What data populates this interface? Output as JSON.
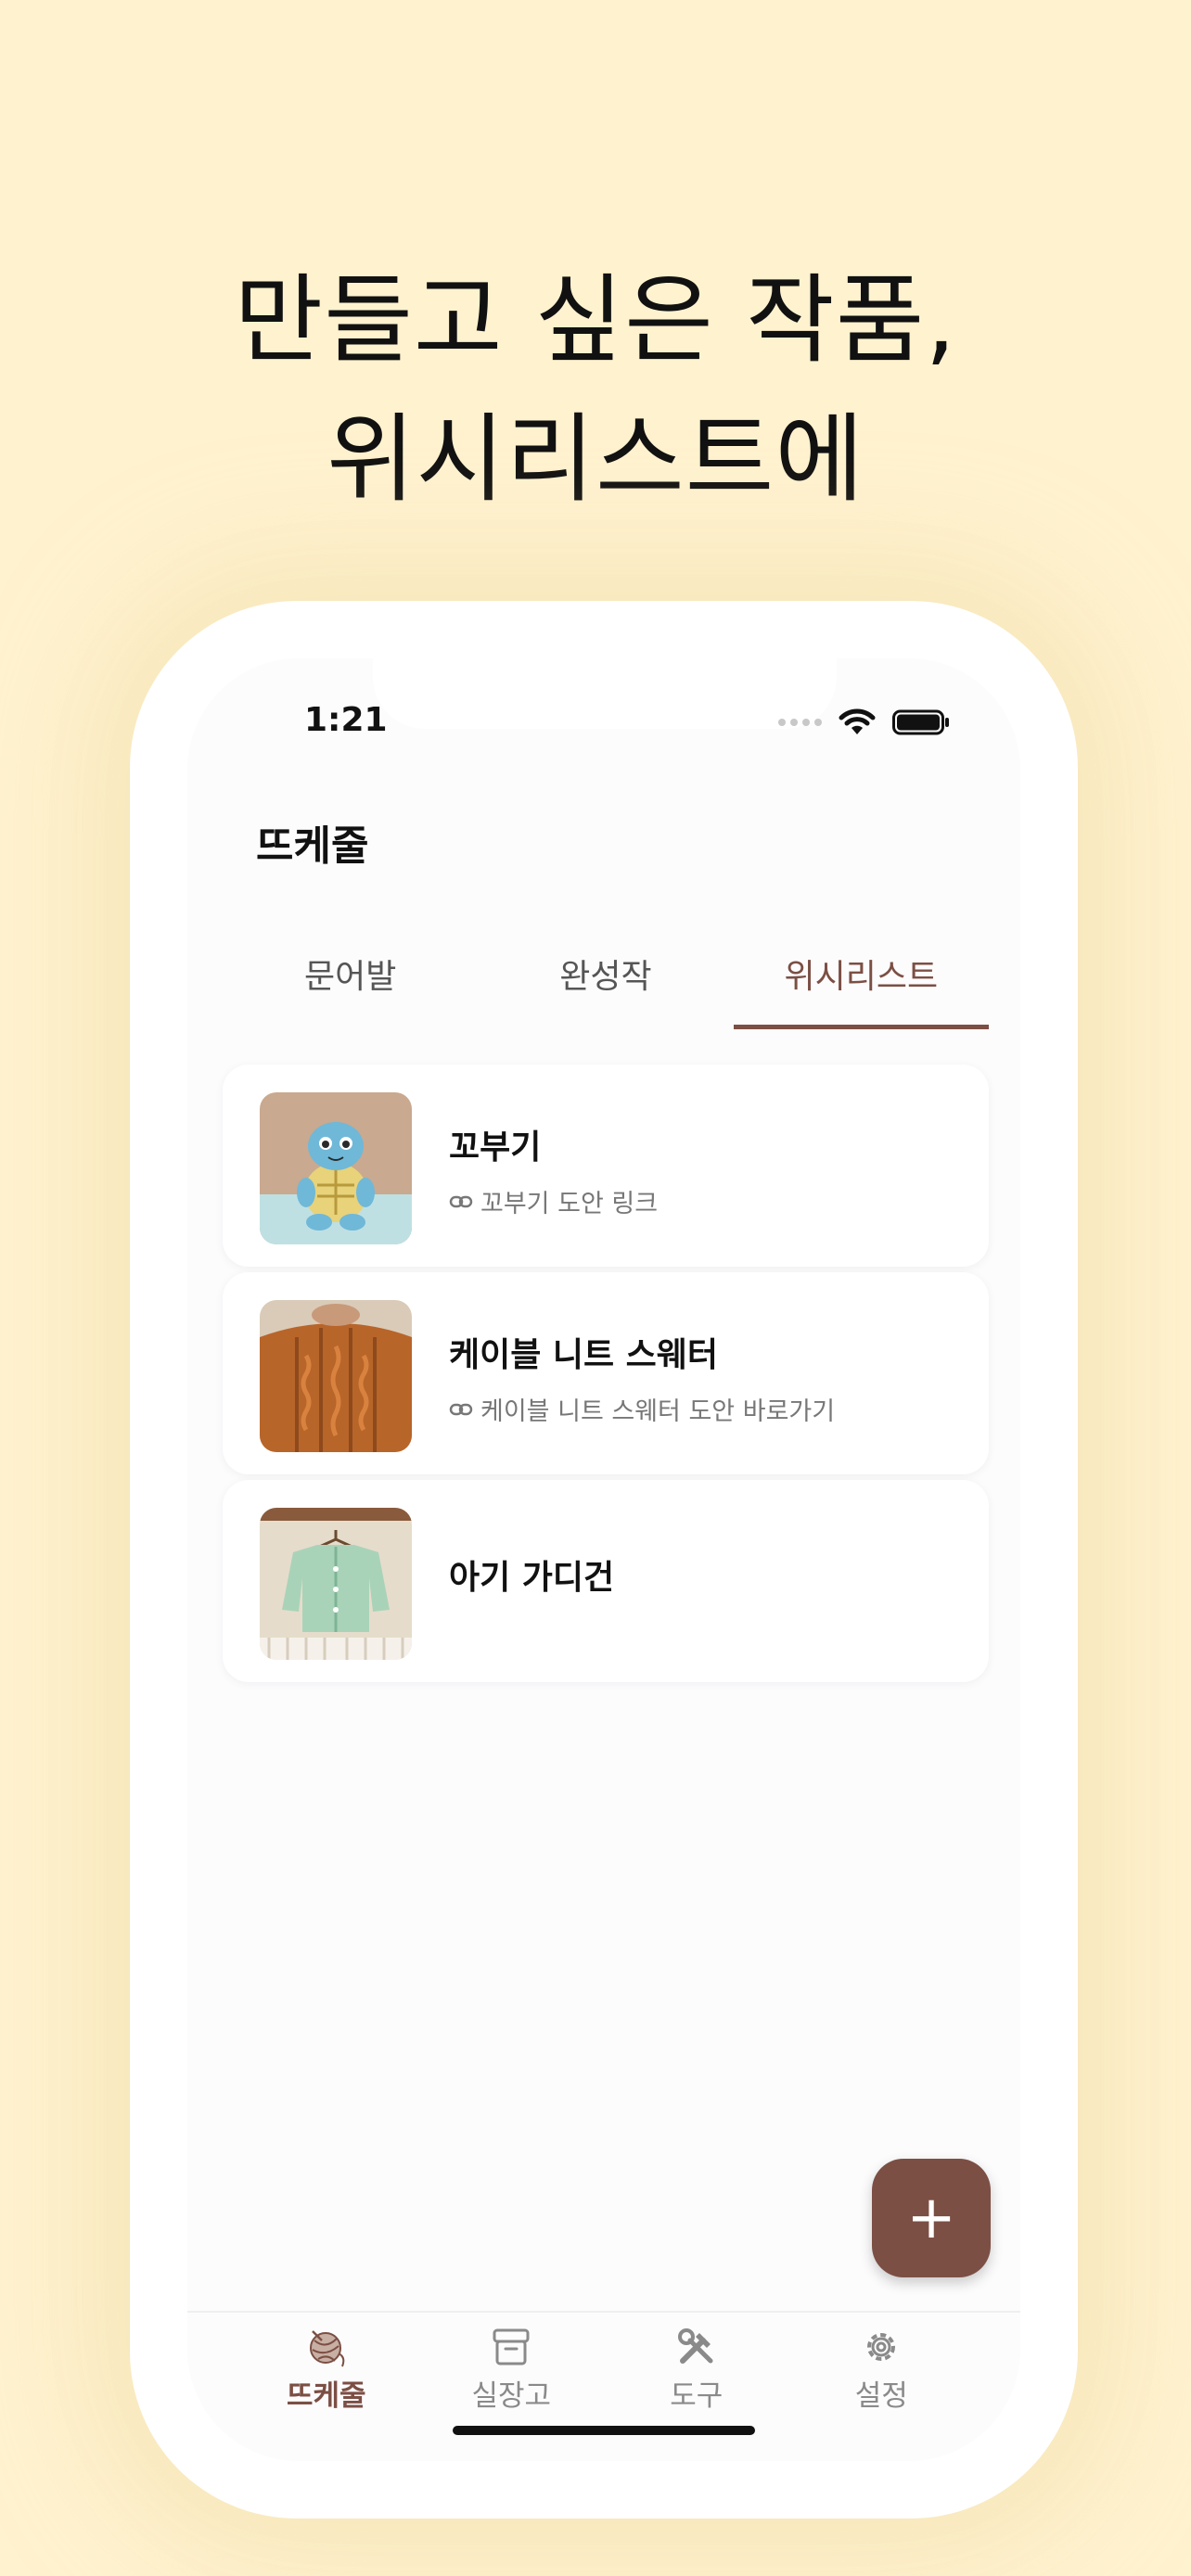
{
  "headline": {
    "line1": "만들고 싶은 작품,",
    "line2": "위시리스트에"
  },
  "status_bar": {
    "time": "1:21"
  },
  "app": {
    "title": "뜨케줄"
  },
  "tabs": [
    {
      "label": "문어발",
      "active": false
    },
    {
      "label": "완성작",
      "active": false
    },
    {
      "label": "위시리스트",
      "active": true
    }
  ],
  "wishlist": [
    {
      "title": "꼬부기",
      "link_text": "꼬부기 도안 링크",
      "image": "crochet-squirtle-plush"
    },
    {
      "title": "케이블 니트 스웨터",
      "link_text": "케이블 니트 스웨터 도안 바로가기",
      "image": "orange-cable-knit-sweater"
    },
    {
      "title": "아기 가디건",
      "link_text": "",
      "image": "mint-baby-cardigan"
    }
  ],
  "fab": {
    "label": "+"
  },
  "bottom_nav": [
    {
      "label": "뜨케줄",
      "icon": "yarn-ball-icon",
      "active": true
    },
    {
      "label": "실장고",
      "icon": "archive-box-icon",
      "active": false
    },
    {
      "label": "도구",
      "icon": "tools-icon",
      "active": false
    },
    {
      "label": "설정",
      "icon": "gear-icon",
      "active": false
    }
  ],
  "colors": {
    "background": "#FFF2CF",
    "accent": "#7C4F44",
    "card": "#FFFFFF"
  }
}
